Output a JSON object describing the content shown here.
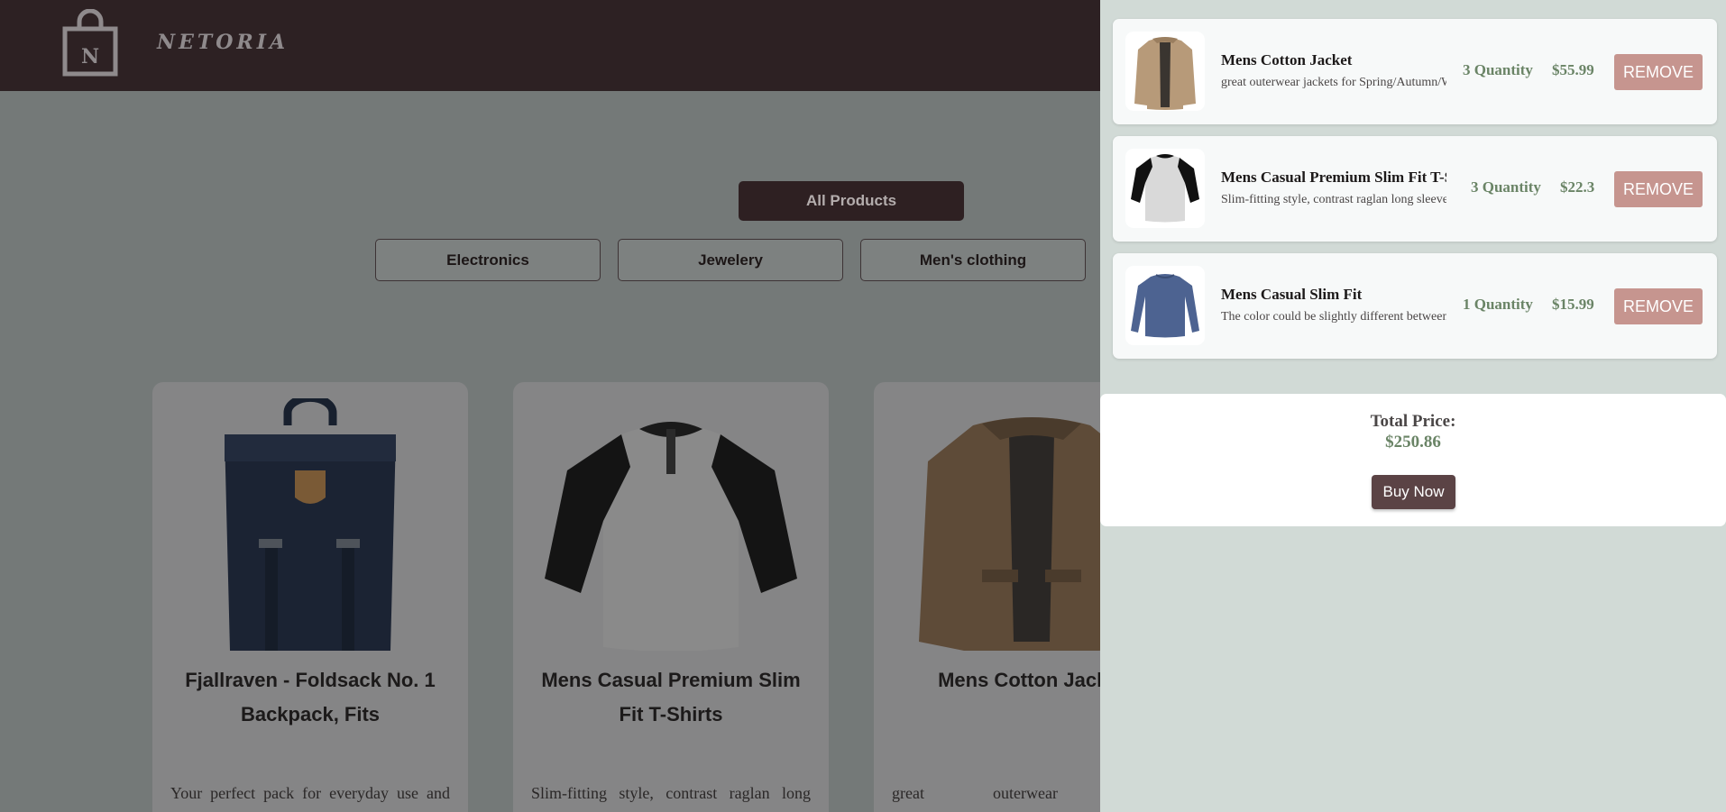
{
  "header": {
    "logo_letter": "N",
    "brand_name": "NETORIA"
  },
  "filters": {
    "all_label": "All Products",
    "categories": [
      "Electronics",
      "Jewelery",
      "Men's clothing"
    ]
  },
  "products": [
    {
      "title": "Fjallraven - Foldsack No. 1 Backpack, Fits",
      "description": "Your perfect pack for everyday use and",
      "icon": "backpack-image"
    },
    {
      "title": "Mens Casual Premium Slim Fit T-Shirts",
      "description": "Slim-fitting style, contrast raglan long",
      "icon": "raglan-shirt-image"
    },
    {
      "title": "Mens Cotton Jacket",
      "description": "great outerwear jackets",
      "icon": "jacket-image"
    }
  ],
  "cart": {
    "items": [
      {
        "name": "Mens Cotton Jacket",
        "description": "great outerwear jackets for Spring/Autumn/Winter",
        "quantity": "3 Quantity",
        "price": "$55.99",
        "remove_label": "REMOVE",
        "icon": "jacket-thumbnail"
      },
      {
        "name": "Mens Casual Premium Slim Fit T-Shirts",
        "description": "Slim-fitting style, contrast raglan long sleeve",
        "quantity": "3 Quantity",
        "price": "$22.3",
        "remove_label": "REMOVE",
        "icon": "raglan-shirt-thumbnail"
      },
      {
        "name": "Mens Casual Slim Fit",
        "description": "The color could be slightly different between on the screen",
        "quantity": "1 Quantity",
        "price": "$15.99",
        "remove_label": "REMOVE",
        "icon": "blue-longsleeve-thumbnail"
      }
    ],
    "total_label": "Total Price:",
    "total_value": "$250.86",
    "buy_label": "Buy Now"
  },
  "colors": {
    "header_bg": "#2d2123",
    "overlay_bg": "#747978",
    "drawer_bg": "#d1dad6",
    "accent_green": "#6a8466",
    "remove_btn": "#c6958f",
    "buy_btn": "#5b4345"
  }
}
